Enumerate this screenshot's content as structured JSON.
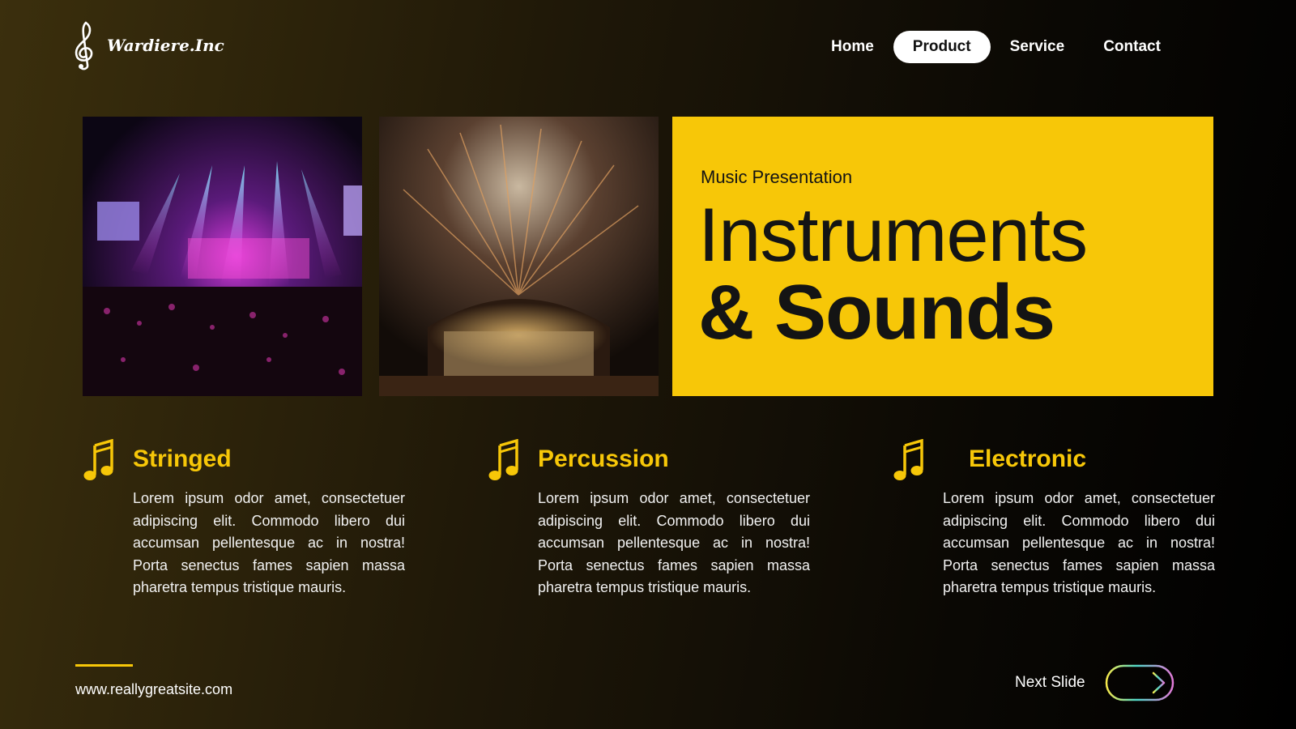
{
  "brand": {
    "name": "Wardiere.Inc",
    "logo_icon": "treble-clef-icon"
  },
  "nav": {
    "items": [
      "Home",
      "Product",
      "Service",
      "Contact"
    ],
    "active": "Product"
  },
  "photos": [
    {
      "label": "concert-stage-photo"
    },
    {
      "label": "fireworks-stage-photo"
    }
  ],
  "hero": {
    "kicker": "Music Presentation",
    "title_line1": "Instruments",
    "title_line2": "& Sounds",
    "background": "#f7c708"
  },
  "features": [
    {
      "icon": "music-note-icon",
      "title": "Stringed",
      "body": "Lorem ipsum odor amet, consectetuer adipiscing elit. Commodo libero dui accumsan pellentesque ac in nostra! Porta senectus fames sapien massa pharetra tempus tristique mauris."
    },
    {
      "icon": "music-note-icon",
      "title": "Percussion",
      "body": "Lorem ipsum odor amet, consectetuer adipiscing elit. Commodo libero dui accumsan pellentesque ac in nostra! Porta senectus fames sapien massa pharetra tempus tristique mauris."
    },
    {
      "icon": "music-note-icon",
      "title": "Electronic",
      "body": "Lorem ipsum odor amet, consectetuer adipiscing elit. Commodo libero dui accumsan pellentesque ac in nostra! Porta senectus fames sapien massa pharetra tempus tristique mauris."
    }
  ],
  "footer": {
    "url": "www.reallygreatsite.com",
    "next_label": "Next Slide",
    "next_icon": "arrow-right-icon"
  },
  "colors": {
    "accent": "#f7c708",
    "background_dark": "#0a0804",
    "background_warm": "#3b2f0d"
  }
}
